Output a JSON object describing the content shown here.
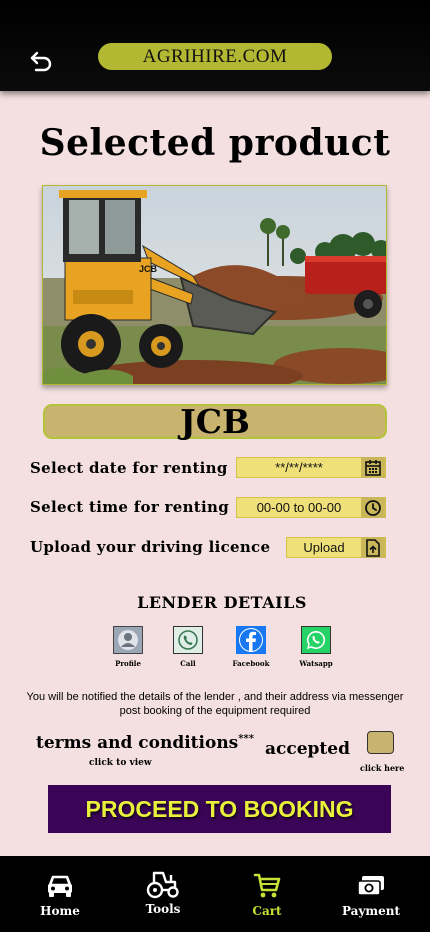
{
  "header": {
    "brand": "AGRIHIRE.COM",
    "back_icon": "back-arrow-icon"
  },
  "page": {
    "title": "Selected product"
  },
  "product": {
    "name": "JCB",
    "image_alt": "JCB backhoe loader digging soil"
  },
  "form": {
    "date": {
      "label": "Select date for renting",
      "value": "**/**/****",
      "icon": "calendar-icon"
    },
    "time": {
      "label": "Select time for renting",
      "value": "00-00 to 00-00",
      "icon": "clock-icon"
    },
    "licence": {
      "label": "Upload your driving licence",
      "value": "Upload",
      "icon": "upload-file-icon"
    }
  },
  "lender": {
    "heading": "LENDER DETAILS",
    "contacts": [
      {
        "label": "Profile",
        "icon": "profile-icon"
      },
      {
        "label": "Call",
        "icon": "phone-icon"
      },
      {
        "label": "Facebook",
        "icon": "facebook-icon"
      },
      {
        "label": "Watsapp",
        "icon": "whatsapp-icon"
      }
    ]
  },
  "notice": "You will be notified the details of the lender , and their address via messenger post booking of the equipment required",
  "terms": {
    "label": "terms and conditions",
    "marks": "***",
    "sub": "click to view",
    "accepted": "accepted",
    "checkbox_hint": "click here"
  },
  "cta": {
    "label": "PROCEED TO BOOKING"
  },
  "nav": {
    "items": [
      {
        "label": "Home",
        "icon": "car-icon"
      },
      {
        "label": "Tools",
        "icon": "tractor-icon"
      },
      {
        "label": "Cart",
        "icon": "cart-icon",
        "active": true
      },
      {
        "label": "Payment",
        "icon": "money-icon"
      }
    ]
  },
  "colors": {
    "accent": "#b3b832",
    "cta_bg": "#3a0556",
    "cta_text": "#e9f23a",
    "background": "#f4e0e0",
    "active_nav": "#c6e236"
  }
}
